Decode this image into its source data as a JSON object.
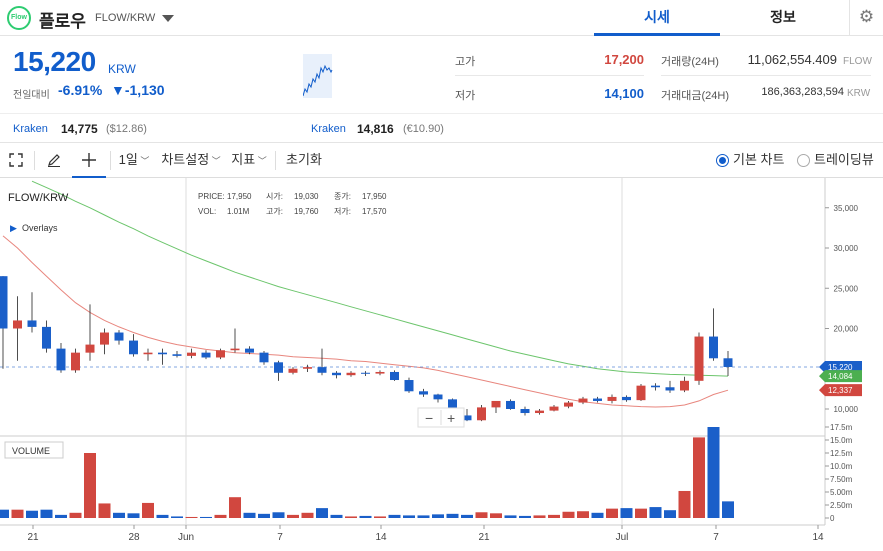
{
  "header": {
    "logo_text": "Flow",
    "coin_name": "플로우",
    "pair": "FLOW/KRW",
    "tabs": [
      {
        "label": "시세",
        "active": true
      },
      {
        "label": "정보",
        "active": false
      }
    ],
    "settings_icon": "gear-icon",
    "dropdown_icon": "caret-down-icon"
  },
  "summary": {
    "price": "15,220",
    "unit": "KRW",
    "change_label": "전일대비",
    "change_pct": "-6.91%",
    "change_abs": "▼-1,130",
    "high_label": "고가",
    "high": "17,200",
    "low_label": "저가",
    "low": "14,100",
    "volume_label": "거래량(24H)",
    "volume": "11,062,554.409",
    "volume_unit": "FLOW",
    "amount_label": "거래대금(24H)",
    "amount": "186,363,283,594",
    "amount_unit": "KRW"
  },
  "exchanges": [
    {
      "name": "Kraken",
      "price": "14,775",
      "usd": "($12.86)"
    },
    {
      "name": "Kraken",
      "price": "14,816",
      "usd": "(€10.90)"
    }
  ],
  "toolbar": {
    "fullscreen_icon": "expand-icon",
    "draw_icon": "pencil-icon",
    "crosshair_icon": "crosshair-icon",
    "interval": "1일",
    "chart_settings": "차트설정",
    "indicators": "지표",
    "reset": "초기화",
    "basic_chart": "기본 차트",
    "trading_view": "트레이딩뷰"
  },
  "chart_labels": {
    "symbol": "FLOW/KRW",
    "overlays": "Overlays",
    "volume_tag": "VOLUME",
    "zoom_out": "−",
    "zoom_in": "+",
    "info": {
      "price_k": "PRICE:",
      "price": "17,950",
      "open_k": "시가:",
      "open": "19,030",
      "close_k": "종가:",
      "close": "17,950",
      "vol_k": "VOL:",
      "vol": "1.01M",
      "high_k": "고가:",
      "high": "19,760",
      "low_k": "저가:",
      "low": "17,570"
    }
  },
  "colors": {
    "up": "#d1473f",
    "down": "#1a5fc9",
    "ma_short": "#e8867e",
    "ma_long": "#6cc56c",
    "accent": "#115dcb"
  },
  "chart_data": {
    "type": "candlestick",
    "title": "FLOW/KRW",
    "price_axis": {
      "ticks": [
        10000,
        15000,
        20000,
        25000,
        30000,
        35000
      ],
      "tick_labels": [
        "10,000",
        "15,000",
        "20,000",
        "25,000",
        "30,000",
        "35,000"
      ]
    },
    "volume_axis": {
      "ticks": [
        0,
        2.5,
        5,
        7.5,
        10,
        12.5,
        15,
        17.5
      ],
      "tick_labels": [
        "0",
        "2.50m",
        "5.00m",
        "7.50m",
        "10.0m",
        "12.5m",
        "15.0m",
        "17.5m"
      ]
    },
    "x_tick_labels": [
      "21",
      "28",
      "Jun",
      "7",
      "14",
      "21",
      "Jul",
      "7",
      "14"
    ],
    "price_badges": [
      {
        "label": "15,220",
        "color": "#1a5fc9"
      },
      {
        "label": "14,084",
        "color": "#4caf50"
      },
      {
        "label": "12,337",
        "color": "#d1473f"
      }
    ],
    "candles": [
      {
        "o": 26500,
        "h": 26500,
        "l": 15000,
        "c": 20000,
        "v": 1.6
      },
      {
        "o": 20000,
        "h": 24000,
        "l": 16000,
        "c": 21000,
        "v": 1.6
      },
      {
        "o": 21000,
        "h": 24500,
        "l": 19500,
        "c": 20200,
        "v": 1.4
      },
      {
        "o": 20200,
        "h": 21000,
        "l": 17000,
        "c": 17500,
        "v": 1.6
      },
      {
        "o": 17500,
        "h": 18200,
        "l": 14500,
        "c": 14800,
        "v": 0.6
      },
      {
        "o": 14800,
        "h": 17500,
        "l": 14500,
        "c": 17000,
        "v": 1.0
      },
      {
        "o": 17000,
        "h": 23000,
        "l": 16000,
        "c": 18000,
        "v": 12.5
      },
      {
        "o": 18000,
        "h": 20000,
        "l": 16800,
        "c": 19500,
        "v": 2.8
      },
      {
        "o": 19500,
        "h": 19800,
        "l": 18000,
        "c": 18500,
        "v": 1.0
      },
      {
        "o": 18500,
        "h": 19300,
        "l": 16500,
        "c": 16800,
        "v": 0.9
      },
      {
        "o": 16800,
        "h": 17500,
        "l": 16000,
        "c": 17000,
        "v": 2.9
      },
      {
        "o": 17000,
        "h": 17500,
        "l": 15500,
        "c": 16800,
        "v": 0.6
      },
      {
        "o": 16800,
        "h": 17200,
        "l": 16400,
        "c": 16600,
        "v": 0.3
      },
      {
        "o": 16600,
        "h": 17500,
        "l": 16300,
        "c": 17000,
        "v": 0.2
      },
      {
        "o": 17000,
        "h": 17300,
        "l": 16200,
        "c": 16400,
        "v": 0.2
      },
      {
        "o": 16400,
        "h": 17500,
        "l": 16200,
        "c": 17300,
        "v": 0.6
      },
      {
        "o": 17300,
        "h": 20000,
        "l": 17000,
        "c": 17500,
        "v": 4.0
      },
      {
        "o": 17500,
        "h": 17800,
        "l": 16800,
        "c": 17000,
        "v": 1.0
      },
      {
        "o": 17000,
        "h": 17200,
        "l": 15500,
        "c": 15800,
        "v": 0.8
      },
      {
        "o": 15800,
        "h": 16000,
        "l": 13500,
        "c": 14500,
        "v": 1.1
      },
      {
        "o": 14500,
        "h": 15200,
        "l": 14300,
        "c": 15000,
        "v": 0.6
      },
      {
        "o": 15000,
        "h": 15500,
        "l": 14600,
        "c": 15200,
        "v": 1.0
      },
      {
        "o": 15200,
        "h": 17500,
        "l": 14200,
        "c": 14500,
        "v": 1.9
      },
      {
        "o": 14500,
        "h": 14700,
        "l": 13800,
        "c": 14200,
        "v": 0.6
      },
      {
        "o": 14200,
        "h": 14700,
        "l": 14000,
        "c": 14500,
        "v": 0.3
      },
      {
        "o": 14500,
        "h": 14700,
        "l": 14100,
        "c": 14400,
        "v": 0.4
      },
      {
        "o": 14400,
        "h": 14800,
        "l": 14200,
        "c": 14600,
        "v": 0.3
      },
      {
        "o": 14600,
        "h": 14800,
        "l": 13500,
        "c": 13600,
        "v": 0.6
      },
      {
        "o": 13600,
        "h": 13900,
        "l": 12000,
        "c": 12200,
        "v": 0.5
      },
      {
        "o": 12200,
        "h": 12500,
        "l": 11500,
        "c": 11800,
        "v": 0.5
      },
      {
        "o": 11800,
        "h": 11900,
        "l": 10800,
        "c": 11200,
        "v": 0.7
      },
      {
        "o": 11200,
        "h": 11300,
        "l": 9000,
        "c": 9200,
        "v": 0.8
      },
      {
        "o": 9200,
        "h": 10000,
        "l": 8500,
        "c": 8600,
        "v": 0.6
      },
      {
        "o": 8600,
        "h": 10500,
        "l": 8500,
        "c": 10200,
        "v": 1.1
      },
      {
        "o": 10200,
        "h": 11000,
        "l": 9500,
        "c": 11000,
        "v": 0.9
      },
      {
        "o": 11000,
        "h": 11200,
        "l": 9900,
        "c": 10000,
        "v": 0.5
      },
      {
        "o": 10000,
        "h": 10300,
        "l": 9200,
        "c": 9500,
        "v": 0.4
      },
      {
        "o": 9500,
        "h": 10000,
        "l": 9300,
        "c": 9800,
        "v": 0.5
      },
      {
        "o": 9800,
        "h": 10500,
        "l": 9700,
        "c": 10300,
        "v": 0.6
      },
      {
        "o": 10300,
        "h": 11000,
        "l": 10100,
        "c": 10800,
        "v": 1.2
      },
      {
        "o": 10800,
        "h": 11500,
        "l": 10600,
        "c": 11300,
        "v": 1.3
      },
      {
        "o": 11300,
        "h": 11500,
        "l": 10800,
        "c": 11000,
        "v": 1.0
      },
      {
        "o": 11000,
        "h": 11800,
        "l": 10700,
        "c": 11500,
        "v": 1.8
      },
      {
        "o": 11500,
        "h": 11700,
        "l": 10900,
        "c": 11100,
        "v": 1.9
      },
      {
        "o": 11100,
        "h": 13100,
        "l": 11000,
        "c": 12900,
        "v": 1.8
      },
      {
        "o": 12900,
        "h": 13200,
        "l": 12300,
        "c": 12700,
        "v": 2.1
      },
      {
        "o": 12700,
        "h": 13500,
        "l": 12000,
        "c": 12300,
        "v": 1.5
      },
      {
        "o": 12300,
        "h": 14000,
        "l": 12100,
        "c": 13500,
        "v": 5.2
      },
      {
        "o": 13500,
        "h": 19500,
        "l": 13000,
        "c": 19000,
        "v": 15.5
      },
      {
        "o": 19000,
        "h": 22500,
        "l": 16000,
        "c": 16300,
        "v": 17.5
      },
      {
        "o": 16300,
        "h": 17200,
        "l": 14100,
        "c": 15220,
        "v": 3.2
      }
    ],
    "ma_short": [
      31500,
      30000,
      28200,
      26500,
      24800,
      23200,
      22000,
      21000,
      20200,
      19500,
      18900,
      18400,
      18000,
      17700,
      17400,
      17200,
      17000,
      16900,
      16800,
      16700,
      16500,
      16400,
      16300,
      16200,
      16000,
      15900,
      15700,
      15500,
      15300,
      15100,
      14800,
      14400,
      14000,
      13600,
      13200,
      12800,
      12400,
      12000,
      11600,
      11200,
      10900,
      10700,
      10500,
      10400,
      10300,
      10250,
      10300,
      10500,
      11000,
      11800,
      12337
    ],
    "ma_long": [
      null,
      null,
      38300,
      37500,
      36700,
      35800,
      35000,
      34100,
      33200,
      32400,
      31500,
      30700,
      29900,
      29100,
      28400,
      27700,
      27000,
      26400,
      25800,
      25200,
      24700,
      24200,
      23700,
      23200,
      22700,
      22200,
      21700,
      21200,
      20700,
      20200,
      19700,
      19200,
      18700,
      18200,
      17700,
      17200,
      16800,
      16400,
      16000,
      15600,
      15300,
      15000,
      14800,
      14600,
      14500,
      14400,
      14300,
      14250,
      14200,
      14150,
      14084
    ]
  }
}
